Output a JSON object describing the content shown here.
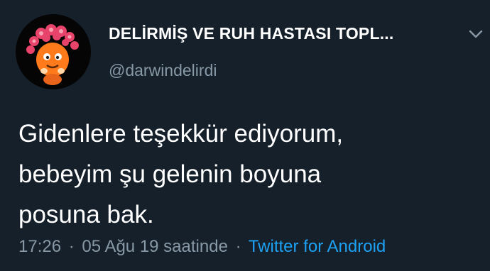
{
  "user": {
    "display_name": "DELİRMİŞ VE RUH HASTASI TOPL...",
    "handle": "@darwindelirdi",
    "avatar_icon": "orange-cartoon-character-avatar-icon"
  },
  "menu": {
    "icon": "chevron-down-icon"
  },
  "tweet": {
    "lines": [
      "Gidenlere teşekkür ediyorum,",
      "bebeyim şu gelenin boyuna",
      "posuna bak."
    ]
  },
  "meta": {
    "time": "17:26",
    "separator": "·",
    "date": "05 Ağu 19 saatinde",
    "source": "Twitter for Android"
  },
  "colors": {
    "background": "#15202b",
    "secondary_text": "#8899a6",
    "link": "#1da1f2"
  }
}
